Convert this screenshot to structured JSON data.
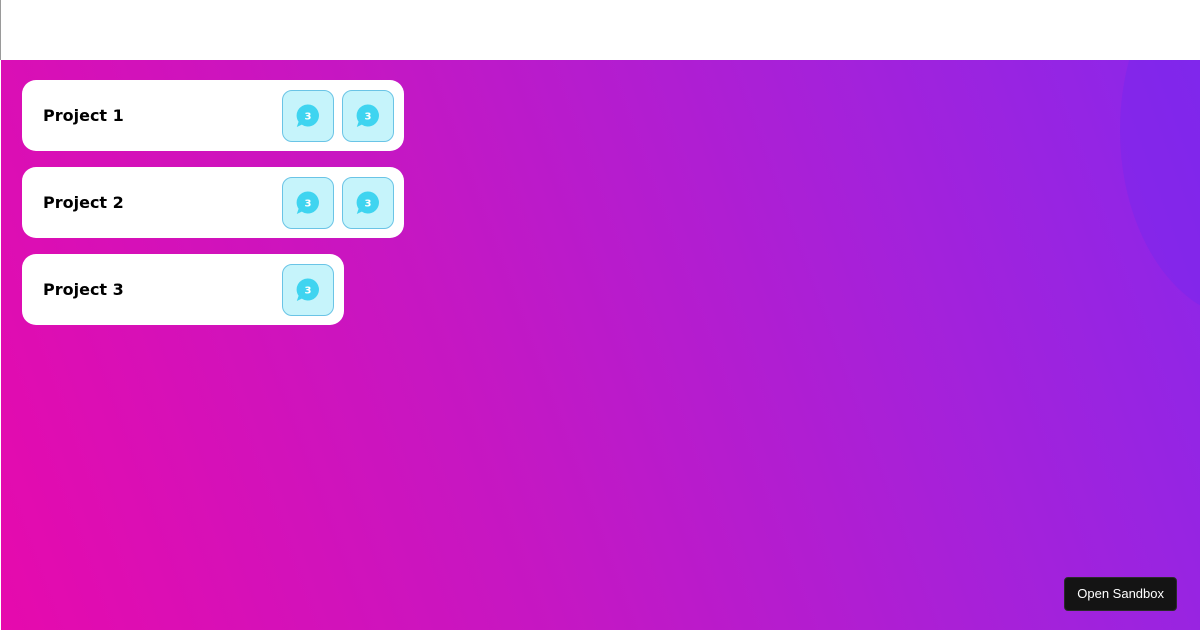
{
  "projects": [
    {
      "title": "Project 1",
      "notifications": [
        "3",
        "3"
      ]
    },
    {
      "title": "Project 2",
      "notifications": [
        "3",
        "3"
      ]
    },
    {
      "title": "Project 3",
      "notifications": [
        "3"
      ]
    }
  ],
  "icons": {
    "notification": "chat-bubble-icon"
  },
  "colors": {
    "gradient_start": "#e60aad",
    "gradient_end": "#8a27ea",
    "badge_bg": "#c6f4fb",
    "badge_icon": "#3fd4f0"
  },
  "footer": {
    "open_sandbox_label": "Open Sandbox"
  }
}
